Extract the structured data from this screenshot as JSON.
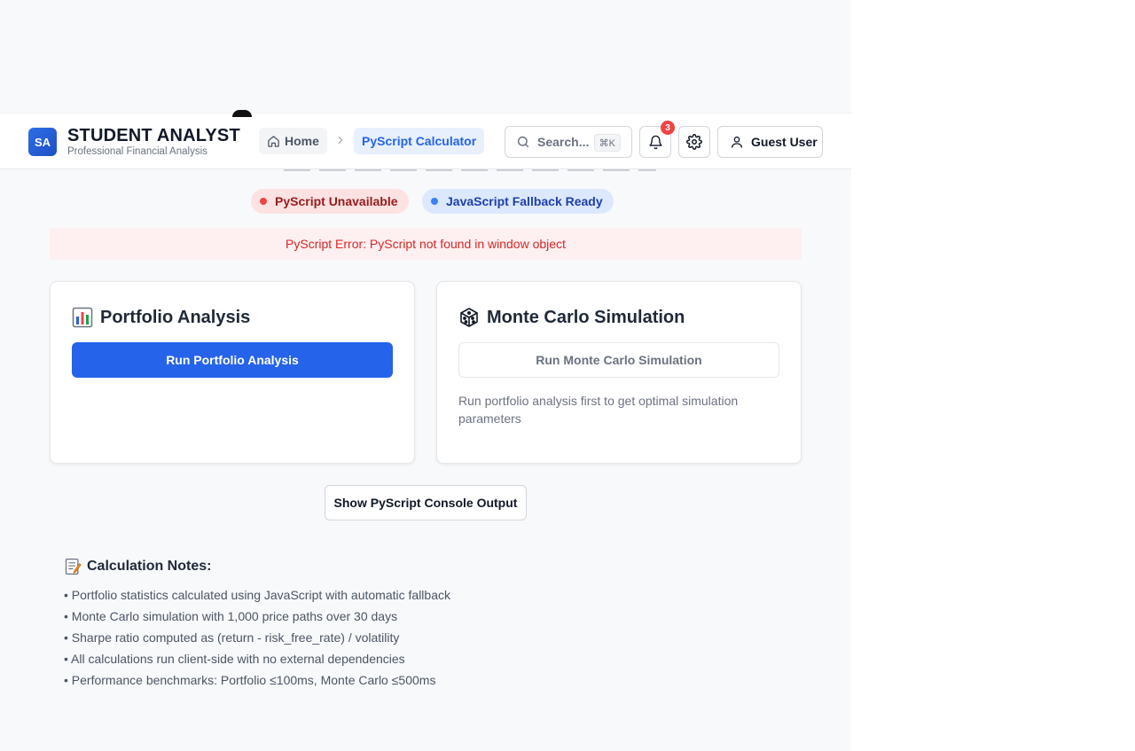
{
  "header": {
    "logo_initials": "SA",
    "app_title": "STUDENT ANALYST",
    "app_subtitle": "Professional Financial Analysis",
    "breadcrumb": {
      "home_label": "Home",
      "current_label": "PyScript Calculator"
    },
    "search": {
      "placeholder": "Search...",
      "shortcut": "⌘K"
    },
    "notifications_count": "3",
    "user_label": "Guest User"
  },
  "status": {
    "pyscript_label": "PyScript Unavailable",
    "pyscript_color": "#ef4444",
    "fallback_label": "JavaScript Fallback Ready",
    "fallback_color": "#3b82f6",
    "error_message": "PyScript Error: PyScript not found in window object"
  },
  "portfolio": {
    "icon": "bar-chart-emoji",
    "title": "Portfolio Analysis",
    "button_label": "Run Portfolio Analysis"
  },
  "monte_carlo": {
    "icon": "dice-emoji",
    "title": "Monte Carlo Simulation",
    "button_label": "Run Monte Carlo Simulation",
    "hint": "Run portfolio analysis first to get optimal simulation parameters"
  },
  "console_button_label": "Show PyScript Console Output",
  "notes": {
    "icon": "memo-emoji",
    "title": "Calculation Notes:",
    "items": [
      "• Portfolio statistics calculated using JavaScript with automatic fallback",
      "• Monte Carlo simulation with 1,000 price paths over 30 days",
      "• Sharpe ratio computed as (return - risk_free_rate) / volatility",
      "• All calculations run client-side with no external dependencies",
      "• Performance benchmarks: Portfolio ≤100ms, Monte Carlo ≤500ms"
    ]
  },
  "colors": {
    "accent": "#2563eb",
    "error_text": "#dc2626",
    "error_bg": "#fef0f0"
  }
}
